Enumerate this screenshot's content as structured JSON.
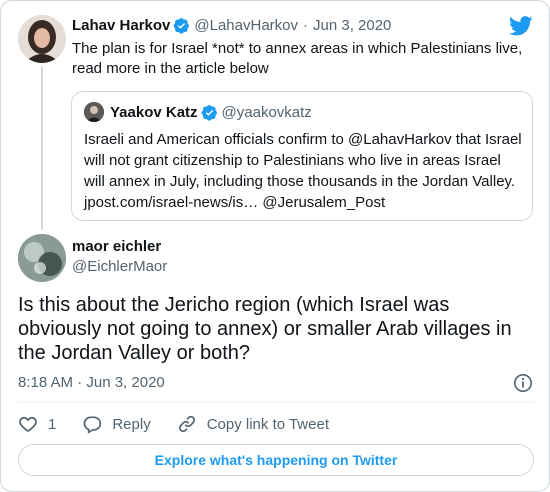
{
  "parent_tweet": {
    "display_name": "Lahav Harkov",
    "handle": "@LahavHarkov",
    "separator": "·",
    "date": "Jun 3, 2020",
    "text": "The plan is for Israel *not* to annex areas in which Palestinians live, read more in the article below"
  },
  "quoted_tweet": {
    "display_name": "Yaakov Katz",
    "handle": "@yaakovkatz",
    "text": "Israeli and American officials confirm to @LahavHarkov that Israel will not grant citizenship to Palestinians who live in areas Israel will annex in July, including those thousands in the Jordan Valley. jpost.com/israel-news/is… @Jerusalem_Post"
  },
  "main_tweet": {
    "display_name": "maor eichler",
    "handle": "@EichlerMaor",
    "text": "Is this about the Jericho region (which Israel was obviously not going to annex) or smaller Arab villages in the Jordan Valley or both?",
    "timestamp": "8:18 AM · Jun 3, 2020"
  },
  "actions": {
    "like_count": "1",
    "reply_label": "Reply",
    "copy_link_label": "Copy link to Tweet"
  },
  "footer": {
    "explore_label": "Explore what's happening on Twitter"
  },
  "icons": {
    "brand": "twitter-bird-icon",
    "verified": "verified-badge-icon",
    "like": "heart-icon",
    "reply": "reply-bubble-icon",
    "copy": "link-icon",
    "info": "info-icon"
  },
  "colors": {
    "brand_blue": "#1d9bf0",
    "text": "#0f1419",
    "muted": "#536471",
    "border": "#cfd9de"
  }
}
